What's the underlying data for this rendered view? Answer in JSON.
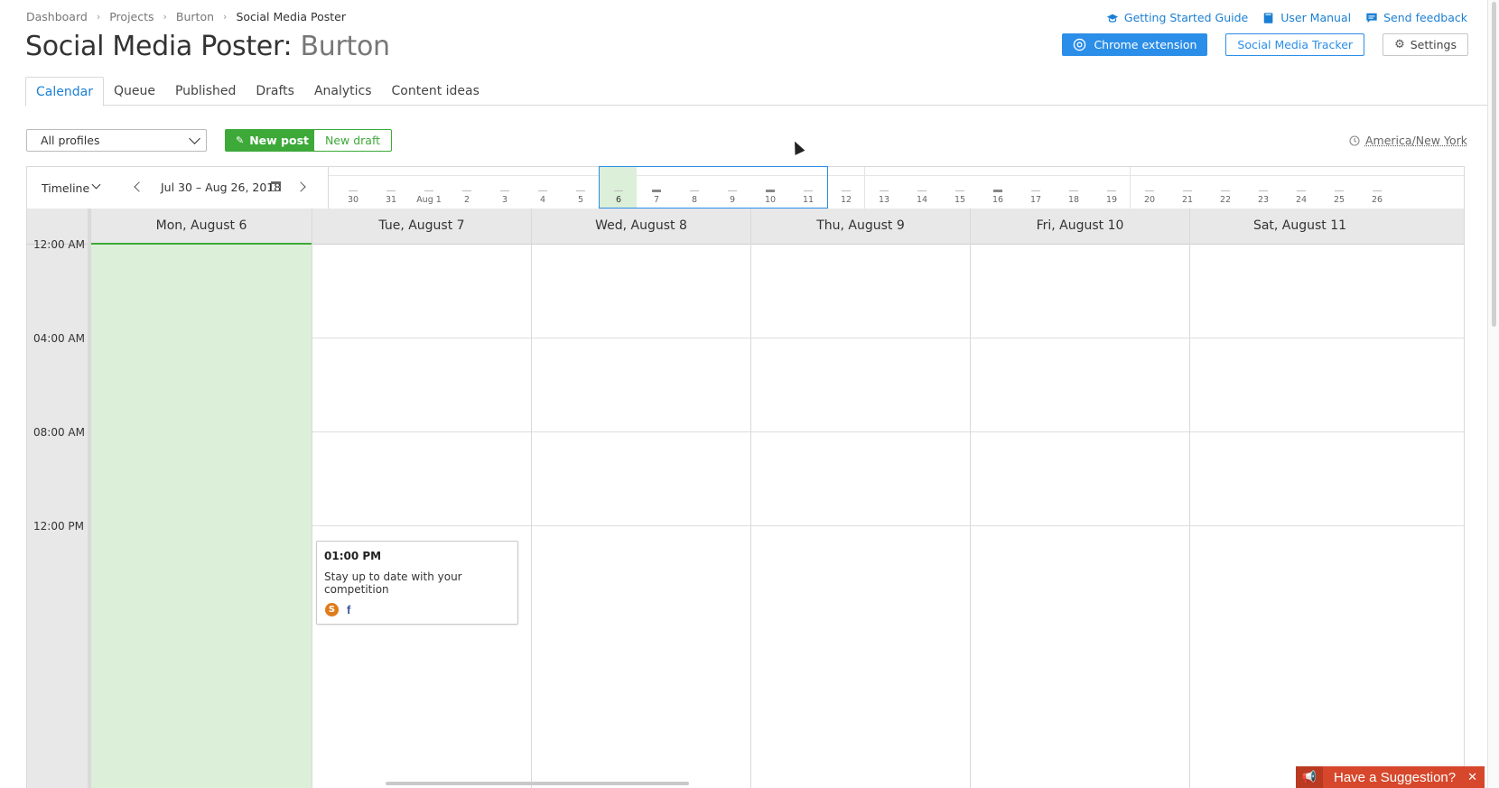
{
  "breadcrumb": [
    "Dashboard",
    "Projects",
    "Burton",
    "Social Media Poster"
  ],
  "title": {
    "main": "Social Media Poster:",
    "project": "Burton"
  },
  "toplinks": {
    "guide": "Getting Started Guide",
    "manual": "User Manual",
    "feedback": "Send feedback"
  },
  "header_buttons": {
    "chrome": "Chrome extension",
    "tracker": "Social Media Tracker",
    "settings": "Settings"
  },
  "tabs": [
    "Calendar",
    "Queue",
    "Published",
    "Drafts",
    "Analytics",
    "Content ideas"
  ],
  "toolbar": {
    "profiles": "All profiles",
    "new_post": "New post",
    "new_draft": "New draft",
    "timezone": "America/New York"
  },
  "timeline": {
    "view": "Timeline",
    "range": "Jul 30 – Aug 26, 2018",
    "days": [
      "30",
      "31",
      "Aug 1",
      "2",
      "3",
      "4",
      "5",
      "6",
      "7",
      "8",
      "9",
      "10",
      "11",
      "12",
      "13",
      "14",
      "15",
      "16",
      "17",
      "18",
      "19",
      "20",
      "21",
      "22",
      "23",
      "24",
      "25",
      "26"
    ],
    "bold_days": [
      "7",
      "10",
      "16"
    ]
  },
  "columns": [
    "Mon, August 6",
    "Tue, August 7",
    "Wed, August 8",
    "Thu, August 9",
    "Fri, August 10",
    "Sat, August 11"
  ],
  "times": [
    "12:00 AM",
    "04:00 AM",
    "08:00 AM",
    "12:00 PM"
  ],
  "event": {
    "time": "01:00 PM",
    "text": "Stay up to date with your competition",
    "avatar": "S",
    "network": "f"
  },
  "suggestion": {
    "label": "Have a Suggestion?",
    "close": "✕"
  },
  "colors": {
    "accent": "#2b8ee8",
    "green": "#3da939",
    "today": "#dcefd9",
    "suggest": "#d6472b"
  }
}
